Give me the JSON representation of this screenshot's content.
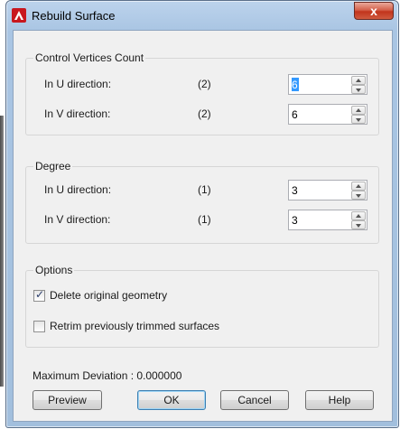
{
  "window": {
    "title": "Rebuild Surface",
    "close_glyph": "x"
  },
  "control_vertices": {
    "legend": "Control Vertices Count",
    "u": {
      "label": "In U direction:",
      "hint": "(2)",
      "value": "6"
    },
    "v": {
      "label": "In V direction:",
      "hint": "(2)",
      "value": "6"
    }
  },
  "degree": {
    "legend": "Degree",
    "u": {
      "label": "In U direction:",
      "hint": "(1)",
      "value": "3"
    },
    "v": {
      "label": "In V direction:",
      "hint": "(1)",
      "value": "3"
    }
  },
  "options": {
    "legend": "Options",
    "delete_original": {
      "label": "Delete original geometry",
      "checked": true
    },
    "retrim": {
      "label": "Retrim previously trimmed surfaces",
      "checked": false
    }
  },
  "footer": {
    "max_deviation": "Maximum Deviation :  0.000000"
  },
  "buttons": {
    "preview": "Preview",
    "ok": "OK",
    "cancel": "Cancel",
    "help": "Help"
  },
  "icons": {
    "app": "autocad-icon",
    "close": "close-icon",
    "spin_up": "chevron-up-icon",
    "spin_down": "chevron-down-icon"
  },
  "colors": {
    "titlebar": "#a9c5e3",
    "close_button": "#c2341c",
    "app_icon": "#c8171e",
    "selection": "#3399ff"
  }
}
